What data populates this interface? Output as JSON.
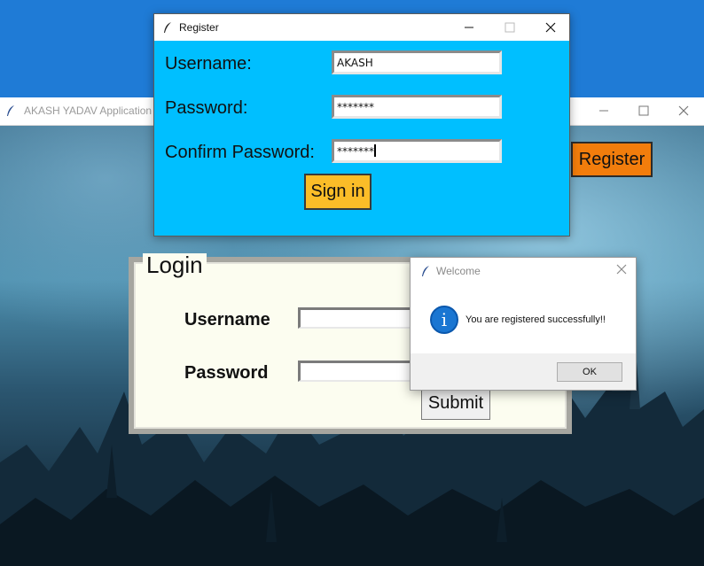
{
  "main_window": {
    "title": "AKASH YADAV Application",
    "register_button": "Register"
  },
  "login": {
    "legend": "Login",
    "username_label": "Username",
    "password_label": "Password",
    "username_value": "",
    "password_value": "",
    "submit_button": "Submit"
  },
  "register_window": {
    "title": "Register",
    "username_label": "Username:",
    "password_label": "Password:",
    "confirm_label": "Confirm Password:",
    "username_value": "AKASH",
    "password_value": "*******",
    "confirm_value": "*******",
    "signin_button": "Sign in"
  },
  "dialog": {
    "title": "Welcome",
    "message": "You are registered successfully!!",
    "ok_button": "OK",
    "icon": "info-icon"
  },
  "window_controls": {
    "minimize": "—",
    "maximize": "☐",
    "close": "✕"
  }
}
